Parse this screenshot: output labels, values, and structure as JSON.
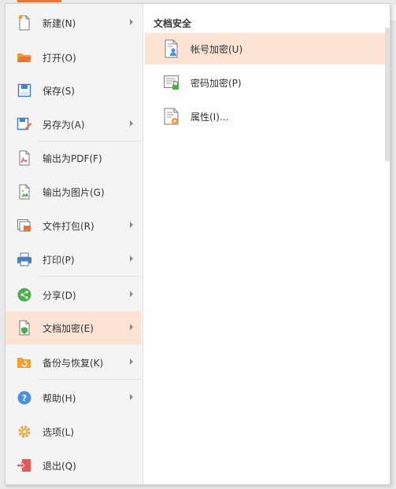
{
  "colors": {
    "accent": "#e2773d",
    "active_bg": "#fde3d4",
    "left_bg": "#f4f4f4"
  },
  "left_menu": {
    "items": [
      {
        "label": "新建(N)",
        "icon": "new-document-icon",
        "has_submenu": true
      },
      {
        "label": "打开(O)",
        "icon": "folder-open-icon",
        "has_submenu": false
      },
      {
        "label": "保存(S)",
        "icon": "save-icon",
        "has_submenu": false
      },
      {
        "label": "另存为(A)",
        "icon": "save-as-icon",
        "has_submenu": true
      },
      {
        "label": "输出为PDF(F)",
        "icon": "pdf-export-icon",
        "has_submenu": false
      },
      {
        "label": "输出为图片(G)",
        "icon": "image-export-icon",
        "has_submenu": false
      },
      {
        "label": "文件打包(R)",
        "icon": "file-package-icon",
        "has_submenu": true
      },
      {
        "label": "打印(P)",
        "icon": "printer-icon",
        "has_submenu": true
      },
      {
        "label": "分享(D)",
        "icon": "share-icon",
        "has_submenu": true
      },
      {
        "label": "文档加密(E)",
        "icon": "document-encrypt-icon",
        "has_submenu": true,
        "active": true
      },
      {
        "label": "备份与恢复(K)",
        "icon": "backup-restore-icon",
        "has_submenu": true
      },
      {
        "label": "帮助(H)",
        "icon": "help-icon",
        "has_submenu": true
      },
      {
        "label": "选项(L)",
        "icon": "gear-icon",
        "has_submenu": false
      },
      {
        "label": "退出(Q)",
        "icon": "exit-icon",
        "has_submenu": false
      }
    ]
  },
  "submenu": {
    "title": "文档安全",
    "items": [
      {
        "label": "帐号加密(U)",
        "icon": "account-encrypt-icon",
        "active": true
      },
      {
        "label": "密码加密(P)",
        "icon": "password-encrypt-icon"
      },
      {
        "label": "属性(I)...",
        "icon": "properties-icon"
      }
    ]
  }
}
